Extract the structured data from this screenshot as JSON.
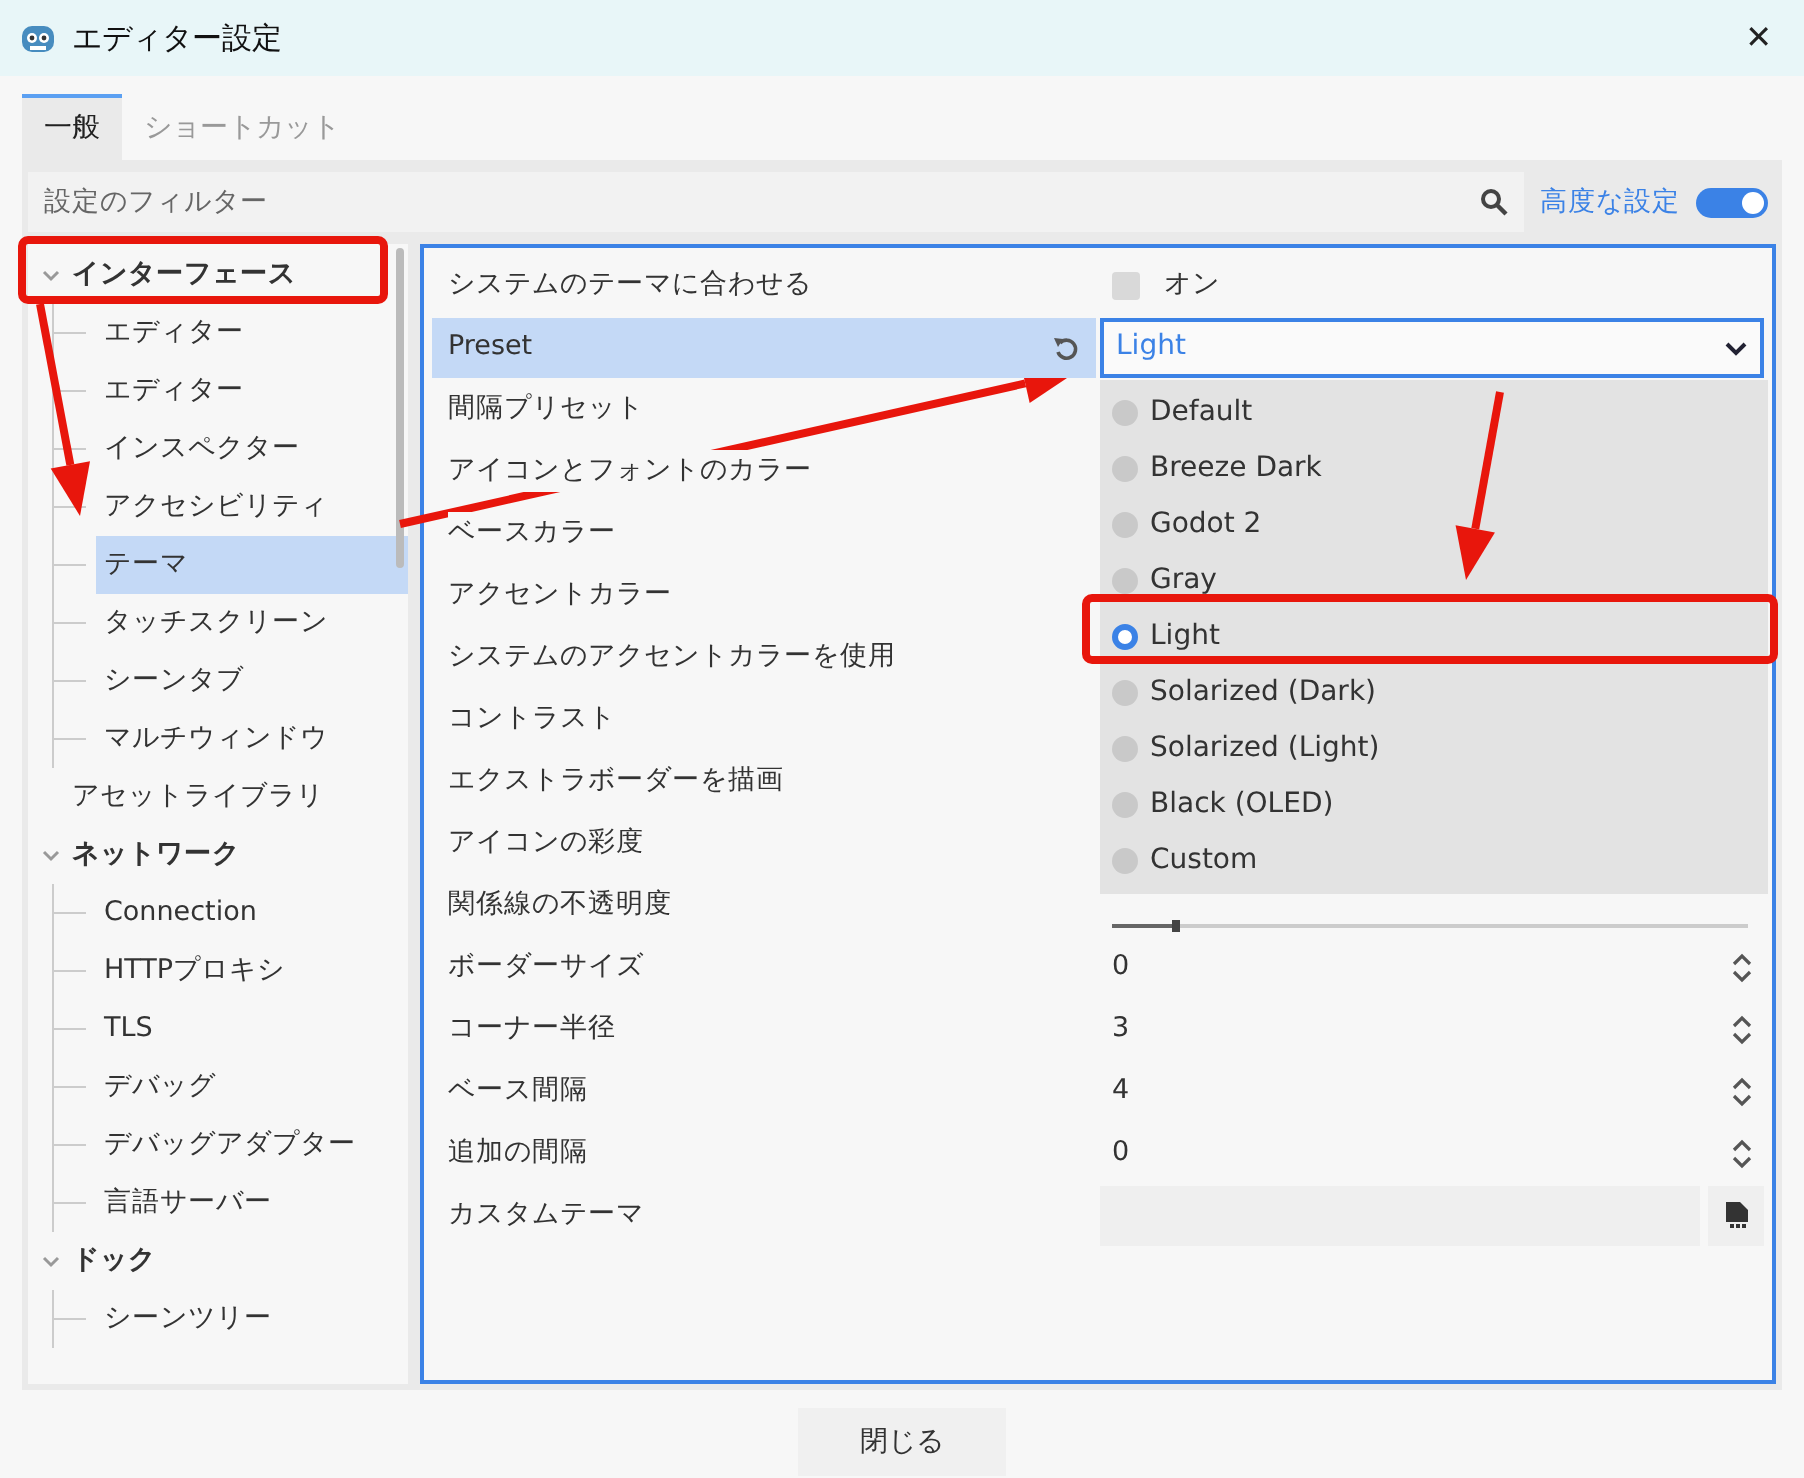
{
  "window": {
    "title": "エディター設定",
    "close": "✕"
  },
  "tabs": [
    {
      "label": "一般",
      "selected": true
    },
    {
      "label": "ショートカット",
      "selected": false
    }
  ],
  "filter": {
    "placeholder": "設定のフィルター"
  },
  "advanced": {
    "label": "高度な設定",
    "on": true
  },
  "tree": [
    {
      "label": "インターフェース",
      "expanded": true,
      "selected": false,
      "children": [
        {
          "label": "エディター",
          "selected": false
        },
        {
          "label": "エディター",
          "selected": false
        },
        {
          "label": "インスペクター",
          "selected": false
        },
        {
          "label": "アクセシビリティ",
          "selected": false
        },
        {
          "label": "テーマ",
          "selected": true
        },
        {
          "label": "タッチスクリーン",
          "selected": false
        },
        {
          "label": "シーンタブ",
          "selected": false
        },
        {
          "label": "マルチウィンドウ",
          "selected": false
        }
      ]
    },
    {
      "label": "アセットライブラリ",
      "selected": false
    },
    {
      "label": "ネットワーク",
      "expanded": true,
      "selected": false,
      "children": [
        {
          "label": "Connection",
          "selected": false
        },
        {
          "label": "HTTPプロキシ",
          "selected": false
        },
        {
          "label": "TLS",
          "selected": false
        },
        {
          "label": "デバッグ",
          "selected": false
        },
        {
          "label": "デバッグアダプター",
          "selected": false
        },
        {
          "label": "言語サーバー",
          "selected": false
        }
      ]
    },
    {
      "label": "ドック",
      "expanded": true,
      "selected": false,
      "children": [
        {
          "label": "シーンツリー",
          "selected": false
        }
      ]
    }
  ],
  "settings": [
    {
      "label": "システムのテーマに合わせる",
      "kind": "checkbox",
      "checked": false,
      "value": "オン",
      "selected": false
    },
    {
      "label": "Preset",
      "kind": "select",
      "value": "Light",
      "selected": true
    },
    {
      "label": "間隔プリセット",
      "kind": "covered",
      "selected": false
    },
    {
      "label": "アイコンとフォントのカラー",
      "kind": "covered",
      "selected": false
    },
    {
      "label": "ベースカラー",
      "kind": "covered",
      "selected": false
    },
    {
      "label": "アクセントカラー",
      "kind": "covered",
      "selected": false
    },
    {
      "label": "システムのアクセントカラーを使用",
      "kind": "covered",
      "selected": false
    },
    {
      "label": "コントラスト",
      "kind": "covered",
      "selected": false
    },
    {
      "label": "エクストラボーダーを描画",
      "kind": "covered",
      "selected": false
    },
    {
      "label": "アイコンの彩度",
      "kind": "covered",
      "selected": false
    },
    {
      "label": "関係線の不透明度",
      "kind": "slider",
      "level": 0.1,
      "selected": false
    },
    {
      "label": "ボーダーサイズ",
      "kind": "spin",
      "value": "0",
      "selected": false
    },
    {
      "label": "コーナー半径",
      "kind": "spin",
      "value": "3",
      "selected": false
    },
    {
      "label": "ベース間隔",
      "kind": "spin",
      "value": "4",
      "selected": false
    },
    {
      "label": "追加の間隔",
      "kind": "spin",
      "value": "0",
      "selected": false
    },
    {
      "label": "カスタムテーマ",
      "kind": "file",
      "selected": false
    }
  ],
  "dropdown": [
    {
      "label": "Default",
      "selected": false
    },
    {
      "label": "Breeze Dark",
      "selected": false
    },
    {
      "label": "Godot 2",
      "selected": false
    },
    {
      "label": "Gray",
      "selected": false
    },
    {
      "label": "Light",
      "selected": true
    },
    {
      "label": "Solarized (Dark)",
      "selected": false
    },
    {
      "label": "Solarized (Light)",
      "selected": false
    },
    {
      "label": "Black (OLED)",
      "selected": false
    },
    {
      "label": "Custom",
      "selected": false
    }
  ],
  "annotations": [
    {
      "kind": "box"
    },
    {
      "kind": "box"
    },
    {
      "kind": "arrow"
    },
    {
      "kind": "arrow"
    },
    {
      "kind": "arrow"
    }
  ],
  "close_button": "閉じる"
}
